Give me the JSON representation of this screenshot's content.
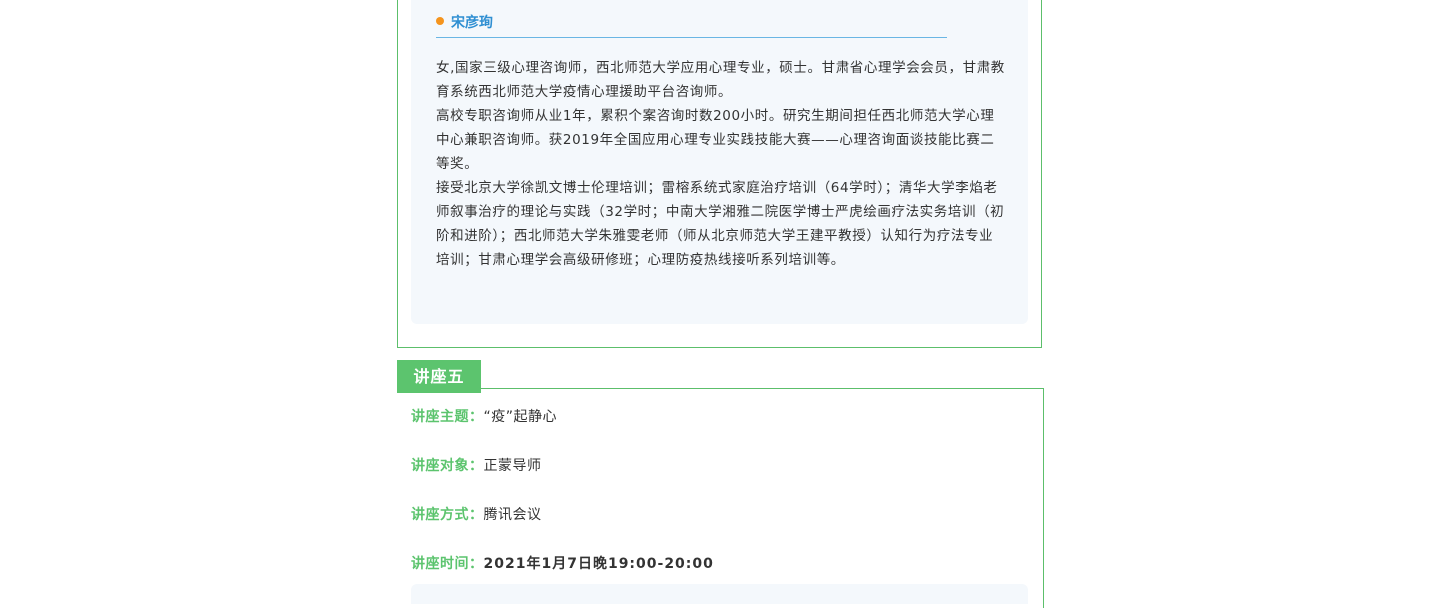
{
  "speaker": {
    "name": "宋彦珣",
    "bio": [
      "女,国家三级心理咨询师，西北师范大学应用心理专业，硕士。甘肃省心理学会会员，甘肃教育系统西北师范大学疫情心理援助平台咨询师。",
      "高校专职咨询师从业1年，累积个案咨询时数200小时。研究生期间担任西北师范大学心理中心兼职咨询师。获2019年全国应用心理专业实践技能大赛——心理咨询面谈技能比赛二等奖。",
      "接受北京大学徐凯文博士伦理培训；雷榕系统式家庭治疗培训（64学时）；清华大学李焰老师叙事治疗的理论与实践（32学时；中南大学湘雅二院医学博士严虎绘画疗法实务培训（初阶和进阶）；西北师范大学朱雅雯老师（师从北京师范大学王建平教授）认知行为疗法专业培训；甘肃心理学会高级研修班；心理防疫热线接听系列培训等。"
    ]
  },
  "lecture": {
    "tag": "讲座五",
    "topic_label": "讲座主题：",
    "topic_value": "“疫”起静心",
    "audience_label": "讲座对象：",
    "audience_value": "正蒙导师",
    "method_label": "讲座方式：",
    "method_value": "腾讯会议",
    "time_label": "讲座时间：",
    "time_value": "2021年1月7日晚19:00-20:00"
  },
  "colors": {
    "accent_green": "#5cc46e",
    "speaker_blue": "#2f8fd2",
    "dot_orange": "#f5941d",
    "card_bg": "#f4f8fc"
  }
}
